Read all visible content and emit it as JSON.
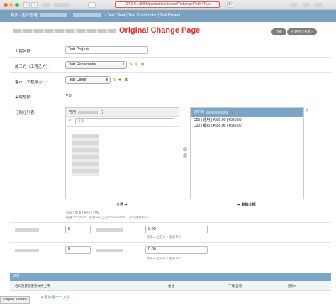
{
  "browser": {
    "url": "127.0.0.1:8000/production/project/7/change/?edit=True",
    "back": "‹",
    "forward": "›",
    "reload": "↻"
  },
  "breadcrumb": {
    "home": "首页",
    "sep": "›",
    "module": "生产管理",
    "tail": "› Test Client | Test Constructor | Test Project"
  },
  "header": {
    "title": "Original Change Page",
    "history_label": "历史",
    "view_on_site_label": "在站点上查看"
  },
  "form": {
    "project_name": {
      "label": "工程名称:",
      "value": "Test Project"
    },
    "constructor": {
      "label": "施工方（工程乙方）:",
      "value": "Test Constructor"
    },
    "client": {
      "label": "客户（工程甲方）:",
      "value": "Test Client"
    },
    "total_purchase": {
      "label": "采购总额:",
      "value": "¥ 0"
    },
    "order_list": {
      "label": "订购砼列表:"
    }
  },
  "selector": {
    "available_title": "可用",
    "filter_placeholder": "过滤",
    "chosen_title": "选中的",
    "chosen_items": [
      "C25 | 通用 | ¥555.00 | ¥525.00",
      "C30 | 细石 | ¥555.00 | ¥545.00"
    ],
    "choose_all": "全选",
    "remove_all": "删除全部",
    "help_line1": "标号 | 配置 | 报价 | 合股",
    "help_line2": "按住 \"Control\"，或者Mac上的 \"Command\"，可以选择多个。"
  },
  "rows": [
    {
      "qty": "0",
      "amount": "0.00",
      "help": "为千一立方米 * 出采单价"
    },
    {
      "qty": "0",
      "amount": "0.00",
      "help": "为千一立方米 * 出采单价"
    }
  ],
  "files": {
    "section_title": "文件",
    "col_name": "合同及其他重要文件上传",
    "col_note": "备注",
    "col_download": "下载/查看",
    "col_delete": "删除?",
    "add_label": "添加另一个 文件",
    "add_icon": "plus-icon"
  },
  "status_tip": "Display a menu",
  "colors": {
    "accent": "#79a5c7",
    "title_red": "#e0322d"
  }
}
